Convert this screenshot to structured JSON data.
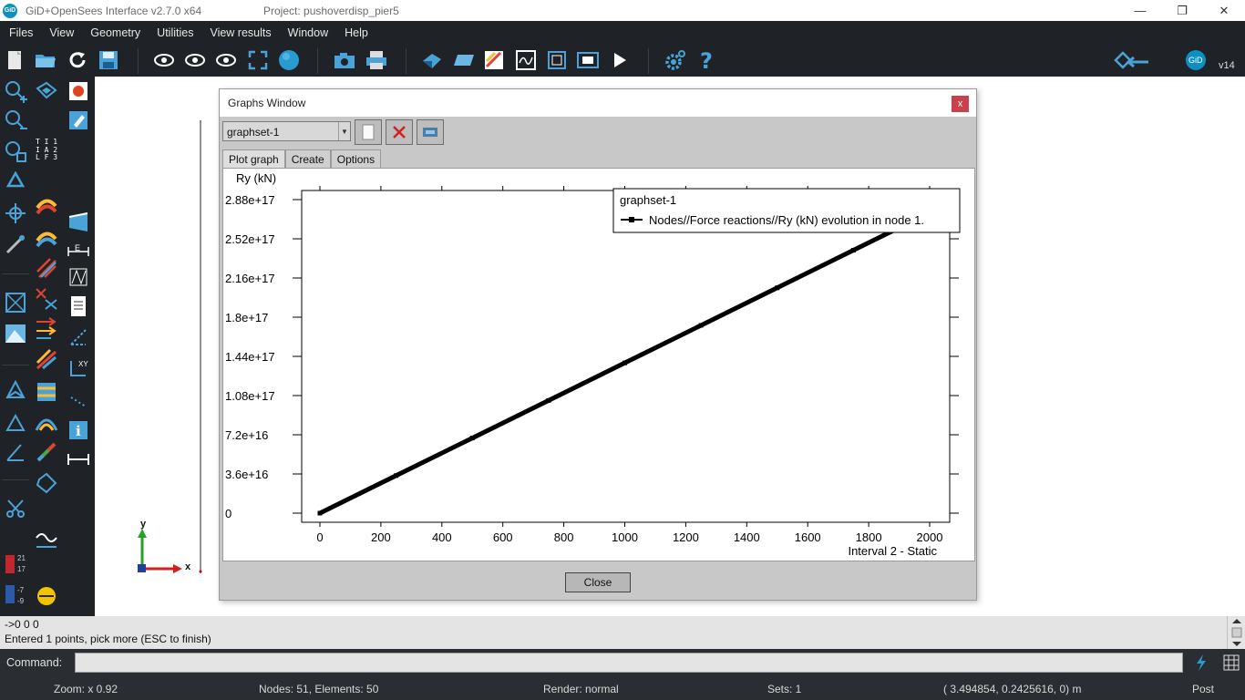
{
  "window": {
    "app_title": "GiD+OpenSees Interface v2.7.0  x64",
    "project_title": "Project: pushoverdisp_pier5",
    "logo_text": "GiD"
  },
  "menu": [
    "Files",
    "View",
    "Geometry",
    "Utilities",
    "View results",
    "Window",
    "Help"
  ],
  "toolbar": {
    "version_label": "v14",
    "logo_text": "GiD"
  },
  "left_tools": {
    "result_legend_top": "21",
    "result_legend_top2": "17",
    "result_legend_bottom": "-7",
    "result_legend_bottom2": "-9"
  },
  "axis_triad": {
    "y_label": "y",
    "x_label": "x"
  },
  "graphs_window": {
    "title": "Graphs Window",
    "close_x": "x",
    "graphset_select": "graphset-1",
    "tabs": [
      "Plot graph",
      "Create",
      "Options"
    ],
    "close_button": "Close"
  },
  "chart_data": {
    "type": "line",
    "ylabel": "Ry (kN)",
    "xlabel": "Interval 2 - Static",
    "legend_title": "graphset-1",
    "legend_placement": "top-right",
    "y_ticks": [
      "0",
      "3.6e+16",
      "7.2e+16",
      "1.08e+17",
      "1.44e+17",
      "1.8e+17",
      "2.16e+17",
      "2.52e+17",
      "2.88e+17"
    ],
    "x_ticks": [
      "0",
      "200",
      "400",
      "600",
      "800",
      "1000",
      "1200",
      "1400",
      "1600",
      "1800",
      "2000"
    ],
    "xlim": [
      0,
      2000
    ],
    "ylim": [
      0,
      2.88e+17
    ],
    "grid": false,
    "series": [
      {
        "name": "Nodes//Force reactions//Ry (kN) evolution in node 1.",
        "color": "#000000",
        "x": [
          0,
          250,
          500,
          750,
          1000,
          1250,
          1500,
          1750,
          2000
        ],
        "y": [
          0,
          3.45e+16,
          6.9e+16,
          1.035e+17,
          1.38e+17,
          1.725e+17,
          2.07e+17,
          2.415e+17,
          2.76e+17
        ]
      }
    ]
  },
  "console": {
    "line1": "->0 0 0",
    "line2": "Entered 1 points, pick more (ESC to finish)"
  },
  "command": {
    "label": "Command:"
  },
  "status": {
    "zoom": "Zoom: x 0.92",
    "nodes": "Nodes: 51, Elements: 50",
    "render": "Render: normal",
    "sets": "Sets: 1",
    "coords": "( 3.494854,  0.2425616,  0)  m",
    "mode": "Post"
  },
  "colors": {
    "chrome": "#1f2226",
    "accent": "#0e8fc1",
    "close_red": "#c9414a"
  }
}
